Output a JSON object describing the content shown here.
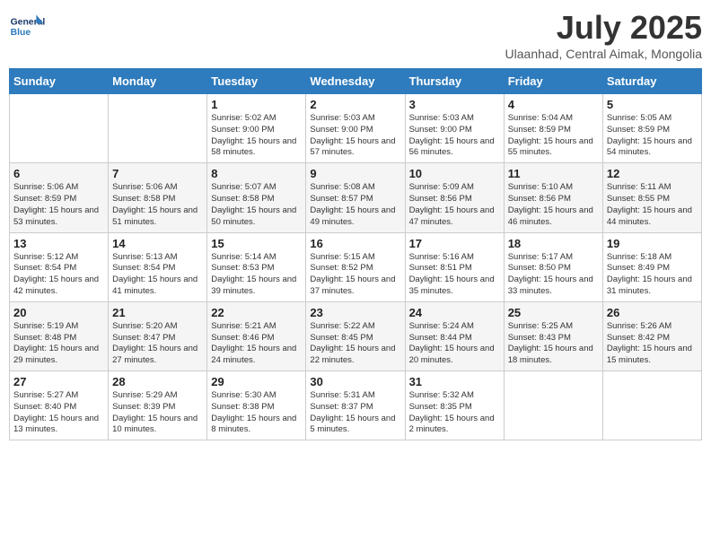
{
  "header": {
    "logo_general": "General",
    "logo_blue": "Blue",
    "month_year": "July 2025",
    "location": "Ulaanhad, Central Aimak, Mongolia"
  },
  "weekdays": [
    "Sunday",
    "Monday",
    "Tuesday",
    "Wednesday",
    "Thursday",
    "Friday",
    "Saturday"
  ],
  "weeks": [
    [
      {
        "day": "",
        "info": ""
      },
      {
        "day": "",
        "info": ""
      },
      {
        "day": "1",
        "sunrise": "5:02 AM",
        "sunset": "9:00 PM",
        "daylight": "15 hours and 58 minutes."
      },
      {
        "day": "2",
        "sunrise": "5:03 AM",
        "sunset": "9:00 PM",
        "daylight": "15 hours and 57 minutes."
      },
      {
        "day": "3",
        "sunrise": "5:03 AM",
        "sunset": "9:00 PM",
        "daylight": "15 hours and 56 minutes."
      },
      {
        "day": "4",
        "sunrise": "5:04 AM",
        "sunset": "8:59 PM",
        "daylight": "15 hours and 55 minutes."
      },
      {
        "day": "5",
        "sunrise": "5:05 AM",
        "sunset": "8:59 PM",
        "daylight": "15 hours and 54 minutes."
      }
    ],
    [
      {
        "day": "6",
        "sunrise": "5:06 AM",
        "sunset": "8:59 PM",
        "daylight": "15 hours and 53 minutes."
      },
      {
        "day": "7",
        "sunrise": "5:06 AM",
        "sunset": "8:58 PM",
        "daylight": "15 hours and 51 minutes."
      },
      {
        "day": "8",
        "sunrise": "5:07 AM",
        "sunset": "8:58 PM",
        "daylight": "15 hours and 50 minutes."
      },
      {
        "day": "9",
        "sunrise": "5:08 AM",
        "sunset": "8:57 PM",
        "daylight": "15 hours and 49 minutes."
      },
      {
        "day": "10",
        "sunrise": "5:09 AM",
        "sunset": "8:56 PM",
        "daylight": "15 hours and 47 minutes."
      },
      {
        "day": "11",
        "sunrise": "5:10 AM",
        "sunset": "8:56 PM",
        "daylight": "15 hours and 46 minutes."
      },
      {
        "day": "12",
        "sunrise": "5:11 AM",
        "sunset": "8:55 PM",
        "daylight": "15 hours and 44 minutes."
      }
    ],
    [
      {
        "day": "13",
        "sunrise": "5:12 AM",
        "sunset": "8:54 PM",
        "daylight": "15 hours and 42 minutes."
      },
      {
        "day": "14",
        "sunrise": "5:13 AM",
        "sunset": "8:54 PM",
        "daylight": "15 hours and 41 minutes."
      },
      {
        "day": "15",
        "sunrise": "5:14 AM",
        "sunset": "8:53 PM",
        "daylight": "15 hours and 39 minutes."
      },
      {
        "day": "16",
        "sunrise": "5:15 AM",
        "sunset": "8:52 PM",
        "daylight": "15 hours and 37 minutes."
      },
      {
        "day": "17",
        "sunrise": "5:16 AM",
        "sunset": "8:51 PM",
        "daylight": "15 hours and 35 minutes."
      },
      {
        "day": "18",
        "sunrise": "5:17 AM",
        "sunset": "8:50 PM",
        "daylight": "15 hours and 33 minutes."
      },
      {
        "day": "19",
        "sunrise": "5:18 AM",
        "sunset": "8:49 PM",
        "daylight": "15 hours and 31 minutes."
      }
    ],
    [
      {
        "day": "20",
        "sunrise": "5:19 AM",
        "sunset": "8:48 PM",
        "daylight": "15 hours and 29 minutes."
      },
      {
        "day": "21",
        "sunrise": "5:20 AM",
        "sunset": "8:47 PM",
        "daylight": "15 hours and 27 minutes."
      },
      {
        "day": "22",
        "sunrise": "5:21 AM",
        "sunset": "8:46 PM",
        "daylight": "15 hours and 24 minutes."
      },
      {
        "day": "23",
        "sunrise": "5:22 AM",
        "sunset": "8:45 PM",
        "daylight": "15 hours and 22 minutes."
      },
      {
        "day": "24",
        "sunrise": "5:24 AM",
        "sunset": "8:44 PM",
        "daylight": "15 hours and 20 minutes."
      },
      {
        "day": "25",
        "sunrise": "5:25 AM",
        "sunset": "8:43 PM",
        "daylight": "15 hours and 18 minutes."
      },
      {
        "day": "26",
        "sunrise": "5:26 AM",
        "sunset": "8:42 PM",
        "daylight": "15 hours and 15 minutes."
      }
    ],
    [
      {
        "day": "27",
        "sunrise": "5:27 AM",
        "sunset": "8:40 PM",
        "daylight": "15 hours and 13 minutes."
      },
      {
        "day": "28",
        "sunrise": "5:29 AM",
        "sunset": "8:39 PM",
        "daylight": "15 hours and 10 minutes."
      },
      {
        "day": "29",
        "sunrise": "5:30 AM",
        "sunset": "8:38 PM",
        "daylight": "15 hours and 8 minutes."
      },
      {
        "day": "30",
        "sunrise": "5:31 AM",
        "sunset": "8:37 PM",
        "daylight": "15 hours and 5 minutes."
      },
      {
        "day": "31",
        "sunrise": "5:32 AM",
        "sunset": "8:35 PM",
        "daylight": "15 hours and 2 minutes."
      },
      {
        "day": "",
        "info": ""
      },
      {
        "day": "",
        "info": ""
      }
    ]
  ]
}
